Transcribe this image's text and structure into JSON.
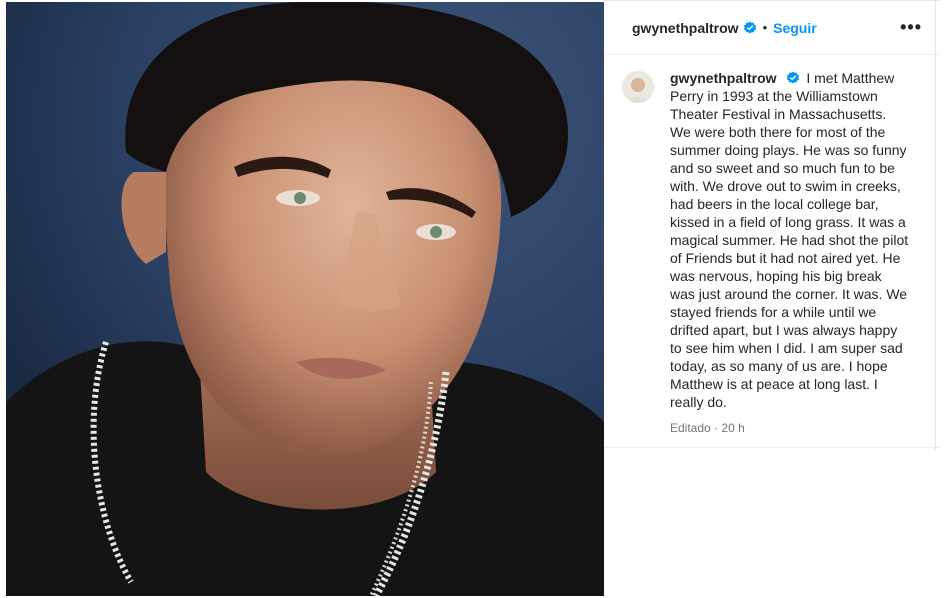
{
  "header": {
    "username": "gwynethpaltrow",
    "separator": "•",
    "follow_label": "Seguir",
    "more_label": "•••"
  },
  "caption": {
    "username": "gwynethpaltrow",
    "text": "I met Matthew Perry in 1993 at the Williamstown Theater Festival in Massachusetts. We were both there for most of the summer doing plays. He was so funny and so sweet and so much fun to be with. We drove out to swim in creeks, had beers in the local college bar, kissed in a field of long grass. It was a magical summer. He had shot the pilot of Friends but it had not aired yet. He was nervous, hoping his big break was just around the corner. It was. We stayed friends for a while until we drifted apart, but I was always happy to see him when I did. I am super sad today, as so many of us are. I hope Matthew is at peace at long last. I really do.",
    "edited_label": "Editado",
    "meta_separator": "·",
    "time": "20 h"
  },
  "icons": {
    "verified": "verified-badge-icon",
    "more": "more-options-icon"
  },
  "colors": {
    "accent": "#0095f6",
    "verified": "#0095f6",
    "photo_background": "#2a4062"
  }
}
